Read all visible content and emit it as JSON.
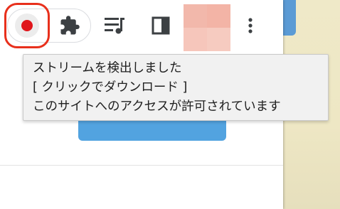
{
  "toolbar": {
    "record_button": {
      "icon": "record-icon",
      "color": "#e0161c",
      "highlight_color": "#e8301c"
    },
    "extensions_button": {
      "icon": "puzzle-icon"
    },
    "reading_list_button": {
      "icon": "reading-list-icon"
    },
    "side_panel_button": {
      "icon": "side-panel-icon"
    },
    "profile_avatar": {
      "icon": "avatar"
    },
    "menu_button": {
      "icon": "kebab-menu-icon"
    }
  },
  "tooltip": {
    "lines": [
      "ストリームを検出しました",
      "[ クリックでダウンロード ]",
      "このサイトへのアクセスが許可されています"
    ]
  },
  "colors": {
    "accent_blue": "#52a3e0",
    "desktop_bg": "#efe9c8"
  }
}
